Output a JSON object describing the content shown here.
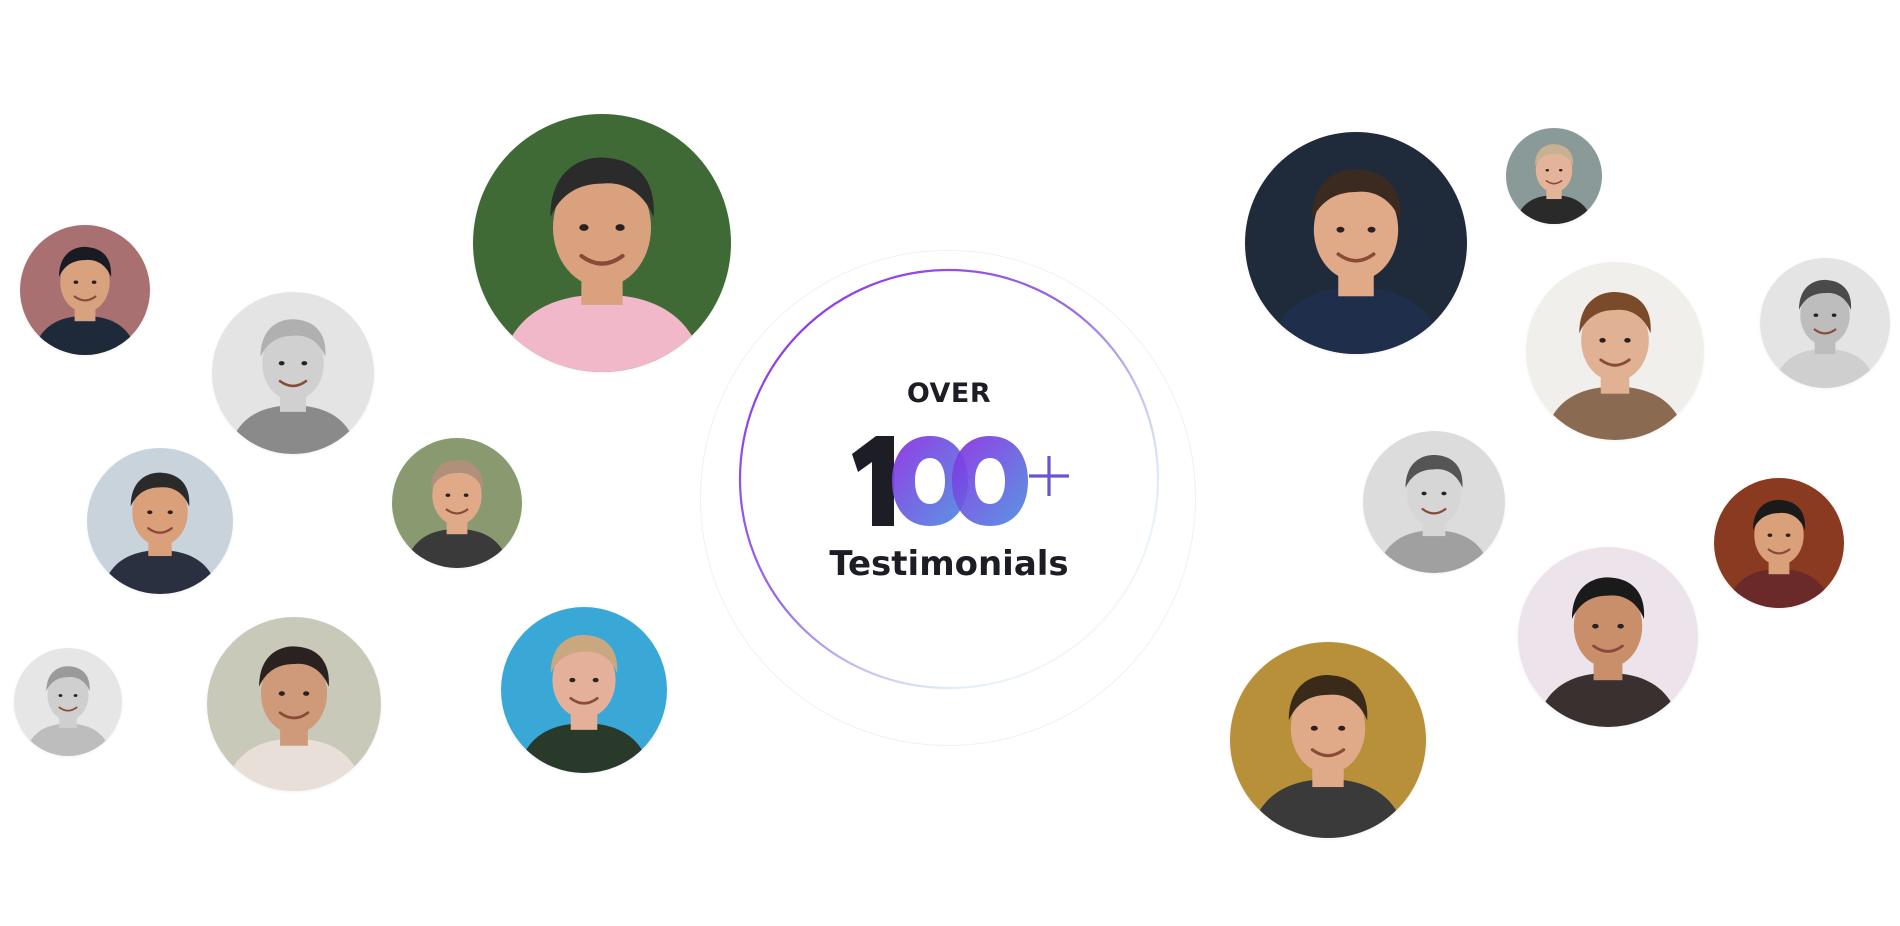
{
  "headline": {
    "prefix": "OVER",
    "count": "100",
    "suffix": "+",
    "label": "Testimonials"
  },
  "colors": {
    "text": "#1c1d25",
    "gradient_start": "#8a2be2",
    "gradient_end": "#4a8ee0",
    "plus": "#6a55d0"
  },
  "avatars": [
    {
      "name": "avatar-left-1",
      "palette": {
        "bg": "#a87070",
        "skin": "#d8a27f",
        "hair": "#1a1a22",
        "shirt": "#1e2a3a"
      }
    },
    {
      "name": "avatar-left-2",
      "palette": {
        "bg": "#e4e4e4",
        "skin": "#d0d0d0",
        "hair": "#b0b0b0",
        "shirt": "#8a8a8a"
      }
    },
    {
      "name": "avatar-left-3",
      "palette": {
        "bg": "#c9d3dc",
        "skin": "#d9a07a",
        "hair": "#2a2a2a",
        "shirt": "#2b3040"
      }
    },
    {
      "name": "avatar-left-4",
      "palette": {
        "bg": "#e6e6e6",
        "skin": "#cfcfcf",
        "hair": "#9a9a9a",
        "shirt": "#bdbdbd"
      }
    },
    {
      "name": "avatar-left-5",
      "palette": {
        "bg": "#c8c9b8",
        "skin": "#cf9a7a",
        "hair": "#2a2220",
        "shirt": "#e8e0d8"
      }
    },
    {
      "name": "avatar-left-6",
      "palette": {
        "bg": "#3f6a35",
        "skin": "#d9a17e",
        "hair": "#2b2b2b",
        "shirt": "#f0b8c8"
      }
    },
    {
      "name": "avatar-left-7",
      "palette": {
        "bg": "#8a9a70",
        "skin": "#e0aa88",
        "hair": "#b0907a",
        "shirt": "#3a3a3a"
      }
    },
    {
      "name": "avatar-left-8",
      "palette": {
        "bg": "#39a8d6",
        "skin": "#e4b09a",
        "hair": "#c9a880",
        "shirt": "#2a3a2a"
      }
    },
    {
      "name": "avatar-right-1",
      "palette": {
        "bg": "#1f2a3a",
        "skin": "#e0aa88",
        "hair": "#3a2a20",
        "shirt": "#1f2e4a"
      }
    },
    {
      "name": "avatar-right-2",
      "palette": {
        "bg": "#8a9a98",
        "skin": "#e4b49a",
        "hair": "#c8b090",
        "shirt": "#2a2a2a"
      }
    },
    {
      "name": "avatar-right-3",
      "palette": {
        "bg": "#f0efec",
        "skin": "#e1b194",
        "hair": "#7a4a2a",
        "shirt": "#8a6a50"
      }
    },
    {
      "name": "avatar-right-4",
      "palette": {
        "bg": "#e4e4e4",
        "skin": "#bdbdbd",
        "hair": "#4a4a4a",
        "shirt": "#cfcfcf"
      }
    },
    {
      "name": "avatar-right-5",
      "palette": {
        "bg": "#dcdcdc",
        "skin": "#d6d6d6",
        "hair": "#555555",
        "shirt": "#a0a0a0"
      }
    },
    {
      "name": "avatar-right-6",
      "palette": {
        "bg": "#8a3a20",
        "skin": "#d9a07a",
        "hair": "#1a1a1a",
        "shirt": "#6a2a2a"
      }
    },
    {
      "name": "avatar-right-7",
      "palette": {
        "bg": "#ece4ea",
        "skin": "#c98f6a",
        "hair": "#1a1a1a",
        "shirt": "#3a3030"
      }
    },
    {
      "name": "avatar-right-8",
      "palette": {
        "bg": "#b8903a",
        "skin": "#e0aa88",
        "hair": "#3a2a1a",
        "shirt": "#3a3a3a"
      }
    }
  ]
}
